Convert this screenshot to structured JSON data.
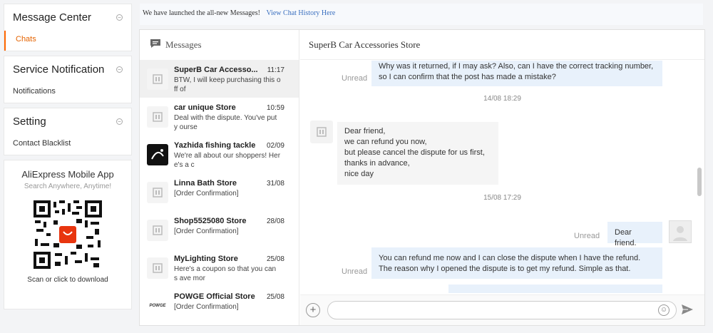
{
  "nav": {
    "sections": [
      {
        "title": "Message Center",
        "items": [
          "Chats"
        ]
      },
      {
        "title": "Service Notification",
        "items": [
          "Notifications"
        ]
      },
      {
        "title": "Setting",
        "items": [
          "Contact Blacklist"
        ]
      }
    ],
    "collapse_symbol": "−"
  },
  "app": {
    "title": "AliExpress Mobile App",
    "subtitle": "Search Anywhere, Anytime!",
    "download": "Scan or click to download",
    "qr_icon": "qr-code-icon"
  },
  "notice": {
    "text": "We have launched the all-new Messages!",
    "link": "View Chat History Here"
  },
  "list": {
    "title": "Messages",
    "conversations": [
      {
        "name": "SuperB Car Accesso...",
        "time": "11:17",
        "preview": "BTW, I will keep purchasing this off of",
        "selected": true,
        "avatar": "store-icon"
      },
      {
        "name": "car unique Store",
        "time": "10:59",
        "preview": "Deal with the dispute. You've put y ourse",
        "avatar": "store-icon"
      },
      {
        "name": "Yazhida fishing tackle",
        "time": "02/09",
        "preview": "We're all about our shoppers! Her e's a c",
        "avatar": "logo-dark"
      },
      {
        "name": "Linna Bath Store",
        "time": "31/08",
        "preview": "[Order Confirmation]",
        "avatar": "store-icon"
      },
      {
        "name": "Shop5525080 Store",
        "time": "28/08",
        "preview": "[Order Confirmation]",
        "avatar": "store-icon"
      },
      {
        "name": "MyLighting Store",
        "time": "25/08",
        "preview": "Here's a coupon so that you can s ave mor",
        "avatar": "store-icon"
      },
      {
        "name": "POWGE Official Store",
        "time": "25/08",
        "preview": "[Order Confirmation]",
        "avatar": "POWGE",
        "logo_text": "POWGE"
      }
    ]
  },
  "chat": {
    "title": "SuperB Car Accessories Store",
    "unread_label": "Unread",
    "messages": [
      {
        "dir": "out",
        "text": "Why was it returned, if I may ask? Also, can I have the correct tracking number, so I can confirm that the post has made a mistake?"
      },
      {
        "stamp": "14/08 18:29"
      },
      {
        "dir": "in",
        "text": "Dear friend,\nwe can refund you now,\nbut please cancel the dispute for us first,\nthanks in advance,\nnice day"
      },
      {
        "stamp": "15/08 17:29"
      },
      {
        "dir": "out",
        "text": "Dear friend."
      },
      {
        "dir": "out",
        "text": "You can refund me now and I can close the dispute when I have the refund. The reason why I opened the dispute is to get my refund. Simple as that."
      }
    ],
    "input_placeholder": "",
    "colors": {
      "outgoing": "#e8f1fb",
      "incoming": "#f5f5f5",
      "accent": "#f60"
    }
  }
}
